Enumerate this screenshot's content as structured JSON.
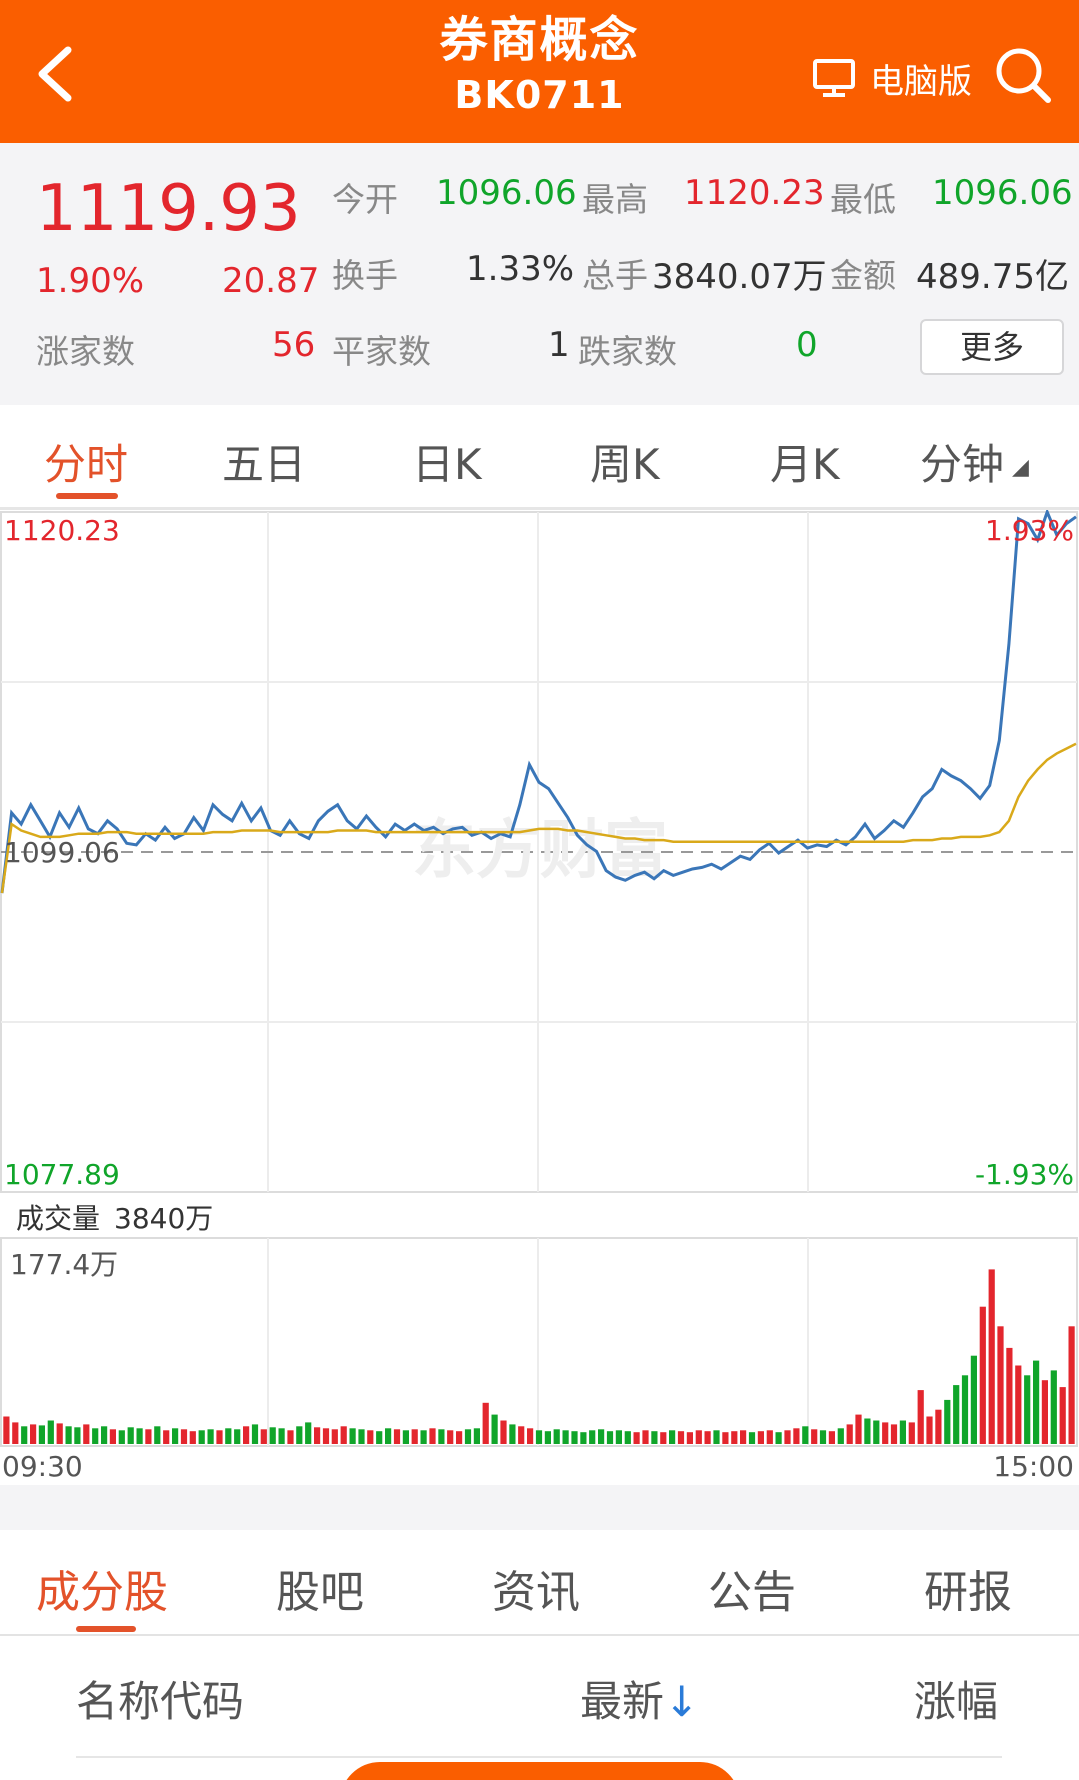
{
  "header": {
    "title": "券商概念",
    "code": "BK0711",
    "pc_version_label": "电脑版",
    "back_icon": "chevron-left-icon",
    "search_icon": "search-icon"
  },
  "quote": {
    "price": "1119.93",
    "change_pct": "1.90%",
    "change_abs": "20.87",
    "open_label": "今开",
    "open_value": "1096.06",
    "high_label": "最高",
    "high_value": "1120.23",
    "low_label": "最低",
    "low_value": "1096.06",
    "turnover_label": "换手",
    "turnover_value": "1.33%",
    "volume_label": "总手",
    "volume_value": "3840.07万",
    "amount_label": "金额",
    "amount_value": "489.75亿",
    "up_label": "涨家数",
    "up_value": "56",
    "flat_label": "平家数",
    "flat_value": "1",
    "down_label": "跌家数",
    "down_value": "0",
    "more_label": "更多"
  },
  "period_tabs": [
    {
      "label": "分时",
      "active": true
    },
    {
      "label": "五日",
      "active": false
    },
    {
      "label": "日K",
      "active": false
    },
    {
      "label": "周K",
      "active": false
    },
    {
      "label": "月K",
      "active": false
    },
    {
      "label": "分钟",
      "active": false
    }
  ],
  "chart_data": [
    {
      "type": "line",
      "y_max_label": "1120.23",
      "y_min_label": "1077.89",
      "baseline_label": "1099.06",
      "pct_max_label": "1.93%",
      "pct_min_label": "-1.93%",
      "ylim": [
        1077.89,
        1120.23
      ],
      "baseline": 1099.06,
      "series": [
        {
          "values": [
            1096.5,
            1101.5,
            1100.8,
            1102.0,
            1101.0,
            1100.0,
            1101.5,
            1100.6,
            1101.8,
            1100.5,
            1100.2,
            1101.0,
            1100.5,
            1099.6,
            1099.5,
            1100.2,
            1099.8,
            1100.6,
            1099.9,
            1100.2,
            1101.2,
            1100.4,
            1102.0,
            1101.4,
            1101.0,
            1102.1,
            1101.0,
            1101.8,
            1100.4,
            1100.1,
            1101.0,
            1100.2,
            1099.9,
            1101.0,
            1101.6,
            1102.0,
            1101.0,
            1100.5,
            1101.3,
            1100.6,
            1100.0,
            1100.8,
            1100.4,
            1100.8,
            1100.4,
            1100.6,
            1100.2,
            1100.5,
            1100.6,
            1100.1,
            1100.3,
            1099.9,
            1100.2,
            1100.0,
            1102.0,
            1104.5,
            1103.4,
            1103.0,
            1102.1,
            1101.2,
            1100.1,
            1099.5,
            1099.1,
            1097.9,
            1097.5,
            1097.3,
            1097.6,
            1097.8,
            1097.4,
            1097.9,
            1097.6,
            1097.8,
            1098.0,
            1098.1,
            1098.3,
            1098.0,
            1098.4,
            1098.8,
            1098.6,
            1099.2,
            1099.6,
            1099.0,
            1099.4,
            1099.8,
            1099.3,
            1099.5,
            1099.4,
            1099.8,
            1099.5,
            1100.0,
            1100.8,
            1099.9,
            1100.4,
            1101.0,
            1100.6,
            1101.5,
            1102.5,
            1103.0,
            1104.2,
            1103.8,
            1103.5,
            1103.0,
            1102.4,
            1103.2,
            1106.0,
            1112.0,
            1119.8,
            1119.5,
            1118.5,
            1120.23,
            1118.8,
            1119.5,
            1119.93
          ]
        },
        {
          "values": [
            1096.5,
            1100.8,
            1100.4,
            1100.2,
            1100.0,
            1100.0,
            1100.0,
            1100.1,
            1100.2,
            1100.2,
            1100.2,
            1100.3,
            1100.3,
            1100.3,
            1100.2,
            1100.2,
            1100.2,
            1100.2,
            1100.2,
            1100.2,
            1100.2,
            1100.2,
            1100.3,
            1100.3,
            1100.3,
            1100.4,
            1100.4,
            1100.4,
            1100.4,
            1100.3,
            1100.3,
            1100.3,
            1100.3,
            1100.3,
            1100.3,
            1100.4,
            1100.4,
            1100.4,
            1100.4,
            1100.3,
            1100.3,
            1100.3,
            1100.3,
            1100.3,
            1100.3,
            1100.3,
            1100.3,
            1100.3,
            1100.3,
            1100.3,
            1100.3,
            1100.3,
            1100.3,
            1100.3,
            1100.3,
            1100.4,
            1100.5,
            1100.5,
            1100.5,
            1100.4,
            1100.4,
            1100.3,
            1100.2,
            1100.1,
            1100.0,
            1099.9,
            1099.9,
            1099.8,
            1099.8,
            1099.8,
            1099.7,
            1099.7,
            1099.7,
            1099.7,
            1099.7,
            1099.7,
            1099.7,
            1099.7,
            1099.7,
            1099.7,
            1099.7,
            1099.7,
            1099.7,
            1099.7,
            1099.7,
            1099.7,
            1099.7,
            1099.7,
            1099.7,
            1099.7,
            1099.7,
            1099.7,
            1099.7,
            1099.7,
            1099.7,
            1099.8,
            1099.8,
            1099.8,
            1099.9,
            1099.9,
            1100.0,
            1100.0,
            1100.0,
            1100.1,
            1100.3,
            1101.0,
            1102.5,
            1103.5,
            1104.2,
            1104.8,
            1105.2,
            1105.5,
            1105.8
          ]
        }
      ]
    },
    {
      "type": "bar",
      "title": "成交量",
      "total_label": "3840万",
      "ymax_label": "177.4万",
      "ylim": [
        0,
        177.4
      ],
      "x_start_label": "09:30",
      "x_end_label": "15:00",
      "values": [
        28,
        22,
        18,
        20,
        19,
        24,
        21,
        18,
        17,
        20,
        16,
        18,
        15,
        14,
        17,
        16,
        15,
        18,
        14,
        16,
        15,
        13,
        14,
        15,
        14,
        16,
        15,
        18,
        20,
        15,
        17,
        16,
        14,
        18,
        22,
        17,
        16,
        15,
        18,
        16,
        15,
        14,
        13,
        16,
        15,
        14,
        15,
        14,
        16,
        15,
        14,
        13,
        15,
        16,
        42,
        30,
        24,
        20,
        18,
        16,
        14,
        13,
        15,
        14,
        13,
        12,
        14,
        15,
        13,
        14,
        13,
        12,
        14,
        13,
        12,
        14,
        13,
        12,
        14,
        13,
        14,
        12,
        13,
        14,
        12,
        13,
        14,
        12,
        14,
        16,
        18,
        15,
        14,
        13,
        16,
        20,
        30,
        26,
        24,
        22,
        20,
        24,
        22,
        55,
        28,
        35,
        45,
        60,
        70,
        90,
        140,
        178,
        120,
        98,
        80,
        70,
        85,
        65,
        75,
        58,
        120
      ],
      "colors_up_down": [
        "#e3262d",
        "#10a52a"
      ]
    }
  ],
  "bottom_tabs": [
    {
      "label": "成分股",
      "active": true
    },
    {
      "label": "股吧",
      "active": false
    },
    {
      "label": "资讯",
      "active": false
    },
    {
      "label": "公告",
      "active": false
    },
    {
      "label": "研报",
      "active": false
    }
  ],
  "list_header": {
    "name_code": "名称代码",
    "latest": "最新",
    "sort_arrow": "↓",
    "change": "涨幅"
  },
  "colors": {
    "brand": "#fa5e00",
    "up": "#e3262d",
    "down": "#10a52a",
    "price_line": "#3a76b8",
    "avg_line": "#d9a91a",
    "active_tab": "#e3522a"
  }
}
